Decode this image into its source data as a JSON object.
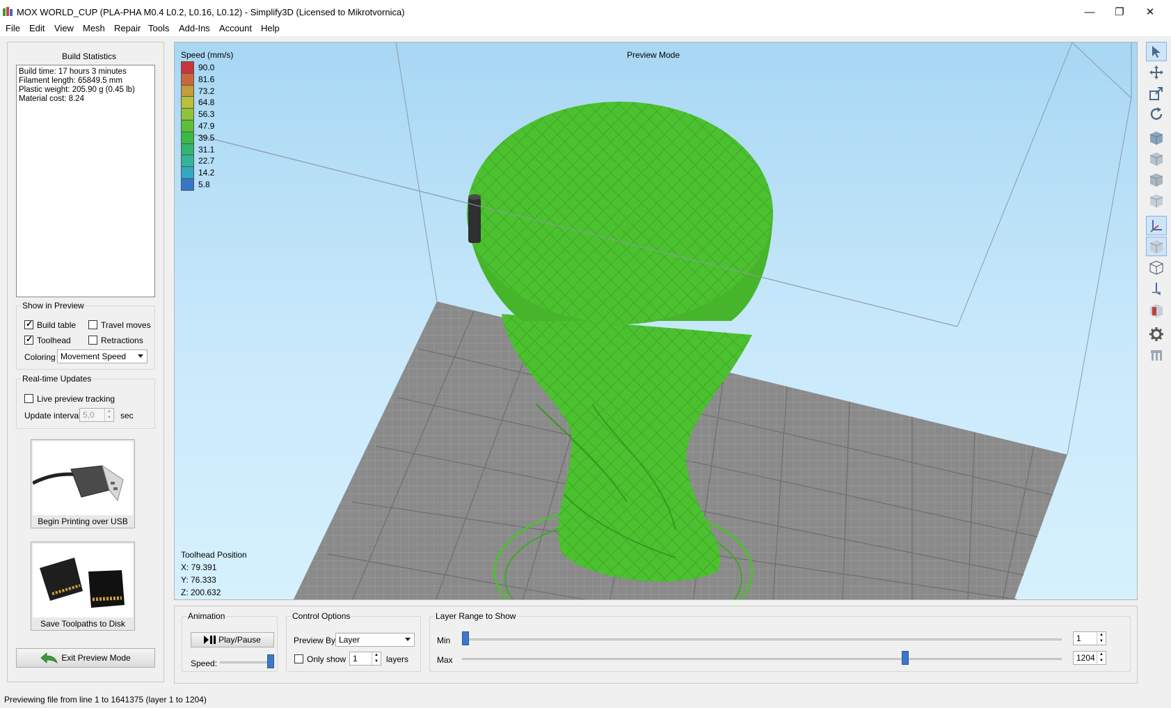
{
  "window": {
    "title": "MOX WORLD_CUP (PLA-PHA M0.4 L0.2, L0.16, L0.12) - Simplify3D (Licensed to Mikrotvornica)",
    "minimize": "—",
    "restore": "❐",
    "close": "✕"
  },
  "menu": [
    "File",
    "Edit",
    "View",
    "Mesh",
    "Repair",
    "Tools",
    "Add-Ins",
    "Account",
    "Help"
  ],
  "build_statistics": {
    "title": "Build Statistics",
    "lines": [
      "Build time: 17 hours 3 minutes",
      "Filament length: 65849.5 mm",
      "Plastic weight: 205.90 g (0.45 lb)",
      "Material cost: 8.24"
    ]
  },
  "show_in_preview": {
    "title": "Show in Preview",
    "build_table": {
      "label": "Build table",
      "checked": true
    },
    "travel_moves": {
      "label": "Travel moves",
      "checked": false
    },
    "toolhead": {
      "label": "Toolhead",
      "checked": true
    },
    "retractions": {
      "label": "Retractions",
      "checked": false
    },
    "coloring_label": "Coloring",
    "coloring_value": "Movement Speed"
  },
  "realtime_updates": {
    "title": "Real-time Updates",
    "live_preview": {
      "label": "Live preview tracking",
      "checked": false
    },
    "interval_label": "Update interval",
    "interval_value": "5,0",
    "interval_unit": "sec"
  },
  "usb_button": {
    "label": "Begin Printing over USB"
  },
  "disk_button": {
    "label": "Save Toolpaths to Disk"
  },
  "exit_button": {
    "label": "Exit Preview Mode"
  },
  "viewport": {
    "legend_title": "Speed (mm/s)",
    "legend": [
      {
        "value": "90.0",
        "color": "#c8353a"
      },
      {
        "value": "81.6",
        "color": "#c9673b"
      },
      {
        "value": "73.2",
        "color": "#c79a3a"
      },
      {
        "value": "64.8",
        "color": "#b9c13a"
      },
      {
        "value": "56.3",
        "color": "#8fc43a"
      },
      {
        "value": "47.9",
        "color": "#5cbf3a"
      },
      {
        "value": "39.5",
        "color": "#3cb944"
      },
      {
        "value": "31.1",
        "color": "#34b46c"
      },
      {
        "value": "22.7",
        "color": "#33b39a"
      },
      {
        "value": "14.2",
        "color": "#31a9c2"
      },
      {
        "value": "5.8",
        "color": "#3476c8"
      }
    ],
    "mode_label": "Preview Mode",
    "toolhead_title": "Toolhead Position",
    "toolhead_x": "X: 79.391",
    "toolhead_y": "Y: 76.333",
    "toolhead_z": "Z: 200.632"
  },
  "animation": {
    "title": "Animation",
    "play_label": "Play/Pause",
    "speed_label": "Speed:",
    "speed_level": 1.0
  },
  "control_options": {
    "title": "Control Options",
    "preview_by_label": "Preview By",
    "preview_by_value": "Layer",
    "only_show_label": "Only show",
    "only_show_checked": false,
    "only_show_value": "1",
    "layers_label": "layers"
  },
  "layer_range": {
    "title": "Layer Range to Show",
    "min_label": "Min",
    "max_label": "Max",
    "min_value": "1",
    "max_value": "1204",
    "total_layers": 1204
  },
  "status": "Previewing file from line 1 to 1641375 (layer 1 to 1204)"
}
